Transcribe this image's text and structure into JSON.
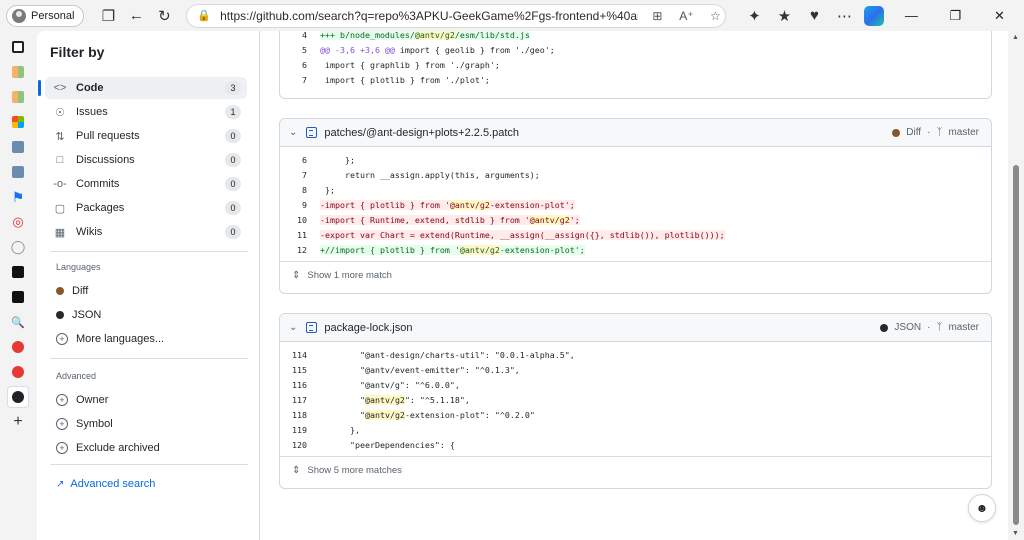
{
  "browser": {
    "profile": "Personal",
    "url": "https://github.com/search?q=repo%3APKU-GeekGame%2Fgs-frontend+%40antv%2F..."
  },
  "filters": {
    "title": "Filter by",
    "items": [
      {
        "label": "Code",
        "count": "3",
        "icon": "code-icon"
      },
      {
        "label": "Issues",
        "count": "1",
        "icon": "issue-opened-icon"
      },
      {
        "label": "Pull requests",
        "count": "0",
        "icon": "git-pull-request-icon"
      },
      {
        "label": "Discussions",
        "count": "0",
        "icon": "comment-discussion-icon"
      },
      {
        "label": "Commits",
        "count": "0",
        "icon": "git-commit-icon"
      },
      {
        "label": "Packages",
        "count": "0",
        "icon": "package-icon"
      },
      {
        "label": "Wikis",
        "count": "0",
        "icon": "book-icon"
      }
    ],
    "languages_heading": "Languages",
    "languages": [
      {
        "label": "Diff",
        "color": "#88562a"
      },
      {
        "label": "JSON",
        "color": "#292929"
      }
    ],
    "more_languages": "More languages...",
    "advanced_heading": "Advanced",
    "advanced": [
      "Owner",
      "Symbol",
      "Exclude archived"
    ],
    "advanced_search": "Advanced search"
  },
  "results": [
    {
      "lines": [
        {
          "n": "4",
          "type": "add",
          "pre": "+++ b/node_modules/",
          "hl": "@antv/g2",
          "post": "/esm/lib/std.js"
        },
        {
          "n": "5",
          "type": "hunk",
          "pre": "@@ -3,6 +3,6 @@",
          "hl": "",
          "post": " import { geolib } from './geo';"
        },
        {
          "n": "6",
          "type": "ctx",
          "pre": " import { graphlib } from './graph';",
          "hl": "",
          "post": ""
        },
        {
          "n": "7",
          "type": "ctx",
          "pre": " import { plotlib } from './plot';",
          "hl": "",
          "post": ""
        }
      ]
    },
    {
      "file": "patches/@ant-design+plots+2.2.5.patch",
      "language": "Diff",
      "lang_color": "#88562a",
      "branch": "master",
      "lines": [
        {
          "n": "6",
          "type": "ctx",
          "pre": "     };",
          "hl": "",
          "post": ""
        },
        {
          "n": "7",
          "type": "ctx",
          "pre": "     return __assign.apply(this, arguments);",
          "hl": "",
          "post": ""
        },
        {
          "n": "8",
          "type": "ctx",
          "pre": " };",
          "hl": "",
          "post": ""
        },
        {
          "n": "9",
          "type": "del",
          "pre": "-import { plotlib } from '",
          "hl": "@antv/g2",
          "post": "-extension-plot';"
        },
        {
          "n": "10",
          "type": "del",
          "pre": "-import { Runtime, extend, stdlib } from '",
          "hl": "@antv/g2",
          "post": "';"
        },
        {
          "n": "11",
          "type": "del",
          "pre": "-export var Chart = extend(Runtime, __assign(__assign({}, stdlib()), plotlib()));",
          "hl": "",
          "post": ""
        },
        {
          "n": "12",
          "type": "add",
          "pre": "+//import { plotlib } from '",
          "hl": "@antv/g2",
          "post": "-extension-plot';"
        }
      ],
      "more": "Show 1 more match"
    },
    {
      "file": "package-lock.json",
      "language": "JSON",
      "lang_color": "#292929",
      "branch": "master",
      "lines": [
        {
          "n": "114",
          "type": "ctx",
          "pre": "        \"@ant-design/charts-util\": \"0.0.1-alpha.5\",",
          "hl": "",
          "post": ""
        },
        {
          "n": "115",
          "type": "ctx",
          "pre": "        \"@antv/event-emitter\": \"^0.1.3\",",
          "hl": "",
          "post": ""
        },
        {
          "n": "116",
          "type": "ctx",
          "pre": "        \"@antv/g\": \"^6.0.0\",",
          "hl": "",
          "post": ""
        },
        {
          "n": "117",
          "type": "ctx",
          "pre": "        \"",
          "hl": "@antv/g2",
          "post": "\": \"^5.1.18\","
        },
        {
          "n": "118",
          "type": "ctx",
          "pre": "        \"",
          "hl": "@antv/g2",
          "post": "-extension-plot\": \"^0.2.0\""
        },
        {
          "n": "119",
          "type": "ctx",
          "pre": "      },",
          "hl": "",
          "post": ""
        },
        {
          "n": "120",
          "type": "ctx",
          "pre": "      \"peerDependencies\": {",
          "hl": "",
          "post": ""
        }
      ],
      "more": "Show 5 more matches"
    }
  ]
}
